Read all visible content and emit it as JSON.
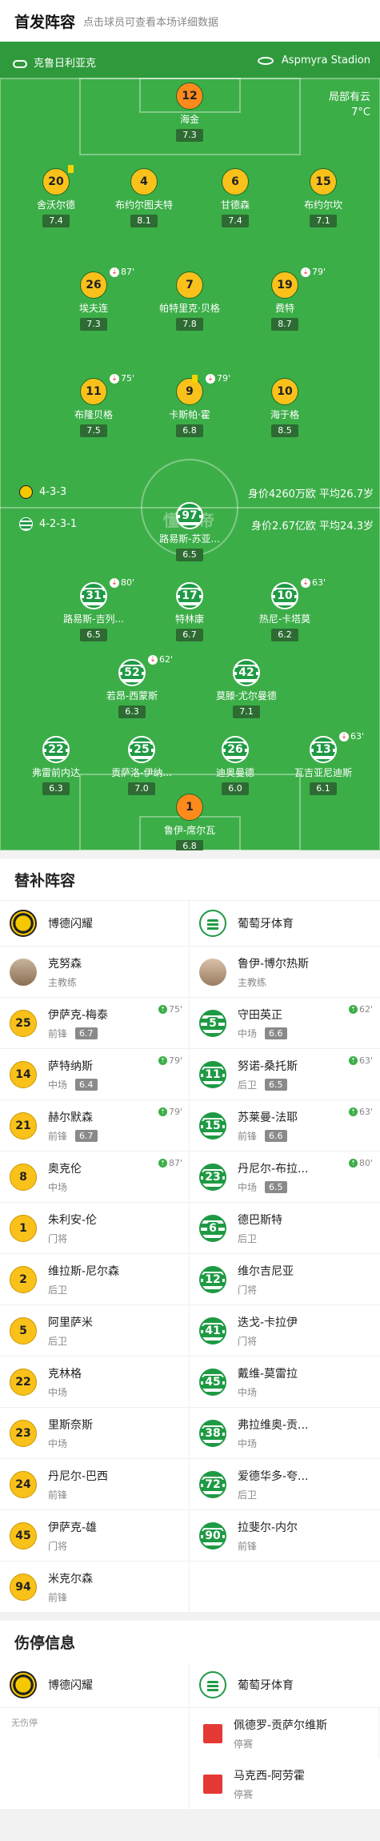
{
  "header": {
    "title": "首发阵容",
    "subtitle": "点击球员可查看本场详细数据"
  },
  "pitch": {
    "home_team": "克鲁日利亚克",
    "venue": "Aspmyra Stadion",
    "weather": "局部有云",
    "temp": "7°C",
    "watermark": "懂球帝",
    "home_formation": "4-3-3",
    "home_stats": "身价4260万欧  平均26.7岁",
    "away_formation": "4-2-3-1",
    "away_stats": "身价2.67亿欧  平均24.3岁",
    "home_players": [
      {
        "num": "12",
        "name": "海金",
        "rating": "7.3"
      },
      {
        "num": "20",
        "name": "舍沃尔德",
        "rating": "7.4"
      },
      {
        "num": "4",
        "name": "布约尔图夫特",
        "rating": "8.1"
      },
      {
        "num": "6",
        "name": "甘德森",
        "rating": "7.4"
      },
      {
        "num": "15",
        "name": "布约尔坎",
        "rating": "7.1"
      },
      {
        "num": "26",
        "name": "埃夫连",
        "rating": "7.3",
        "sub": "87'"
      },
      {
        "num": "7",
        "name": "帕特里克·贝格",
        "rating": "7.8"
      },
      {
        "num": "19",
        "name": "费特",
        "rating": "8.7",
        "sub": "79'"
      },
      {
        "num": "11",
        "name": "布隆贝格",
        "rating": "7.5",
        "sub": "75'"
      },
      {
        "num": "9",
        "name": "卡斯帕·霍",
        "rating": "6.8",
        "sub": "79'"
      },
      {
        "num": "10",
        "name": "海于格",
        "rating": "8.5"
      }
    ],
    "away_players": [
      {
        "num": "97",
        "name": "路易斯-苏亚...",
        "rating": "6.5"
      },
      {
        "num": "31",
        "name": "路易斯-吉列...",
        "rating": "6.5",
        "sub": "80'"
      },
      {
        "num": "17",
        "name": "特林康",
        "rating": "6.7"
      },
      {
        "num": "10",
        "name": "热尼-卡塔莫",
        "rating": "6.2",
        "sub": "63'"
      },
      {
        "num": "52",
        "name": "若昂-西蒙斯",
        "rating": "6.3",
        "sub": "62'"
      },
      {
        "num": "42",
        "name": "莫滕·尤尔曼德",
        "rating": "7.1"
      },
      {
        "num": "22",
        "name": "弗雷前内达",
        "rating": "6.3"
      },
      {
        "num": "25",
        "name": "贡萨洛-伊纳...",
        "rating": "7.0"
      },
      {
        "num": "26",
        "name": "迪奥曼德",
        "rating": "6.0"
      },
      {
        "num": "13",
        "name": "瓦吉亚尼迪斯",
        "rating": "6.1",
        "sub": "63'"
      },
      {
        "num": "1",
        "name": "鲁伊-席尔瓦",
        "rating": "6.8"
      }
    ]
  },
  "subs": {
    "title": "替补阵容",
    "home_team": "博德闪耀",
    "away_team": "葡萄牙体育",
    "home_coach": {
      "name": "克努森",
      "role": "主教练"
    },
    "away_coach": {
      "name": "鲁伊-博尔热斯",
      "role": "主教练"
    },
    "rows": [
      [
        {
          "num": "25",
          "name": "伊萨克-梅泰",
          "pos": "前锋",
          "rating": "6.7",
          "in": "75'"
        },
        {
          "num": "5",
          "name": "守田英正",
          "pos": "中场",
          "rating": "6.6",
          "in": "62'"
        }
      ],
      [
        {
          "num": "14",
          "name": "萨特纳斯",
          "pos": "中场",
          "rating": "6.4",
          "in": "79'"
        },
        {
          "num": "11",
          "name": "努诺-桑托斯",
          "pos": "后卫",
          "rating": "6.5",
          "in": "63'"
        }
      ],
      [
        {
          "num": "21",
          "name": "赫尔默森",
          "pos": "前锋",
          "rating": "6.7",
          "in": "79'"
        },
        {
          "num": "15",
          "name": "苏莱曼-法耶",
          "pos": "前锋",
          "rating": "6.6",
          "in": "63'"
        }
      ],
      [
        {
          "num": "8",
          "name": "奥克伦",
          "pos": "中场",
          "rating": "",
          "in": "87'"
        },
        {
          "num": "23",
          "name": "丹尼尔-布拉...",
          "pos": "中场",
          "rating": "6.5",
          "in": "80'"
        }
      ],
      [
        {
          "num": "1",
          "name": "朱利安-伦",
          "pos": "门将"
        },
        {
          "num": "6",
          "name": "德巴斯特",
          "pos": "后卫"
        }
      ],
      [
        {
          "num": "2",
          "name": "维拉斯-尼尔森",
          "pos": "后卫"
        },
        {
          "num": "12",
          "name": "维尔吉尼亚",
          "pos": "门将"
        }
      ],
      [
        {
          "num": "5",
          "name": "阿里萨米",
          "pos": "后卫"
        },
        {
          "num": "41",
          "name": "迭戈-卡拉伊",
          "pos": "门将"
        }
      ],
      [
        {
          "num": "22",
          "name": "克林格",
          "pos": "中场"
        },
        {
          "num": "45",
          "name": "戴维-莫雷拉",
          "pos": "中场"
        }
      ],
      [
        {
          "num": "23",
          "name": "里斯奈斯",
          "pos": "中场"
        },
        {
          "num": "38",
          "name": "弗拉维奥-贡...",
          "pos": "中场"
        }
      ],
      [
        {
          "num": "24",
          "name": "丹尼尔-巴西",
          "pos": "前锋"
        },
        {
          "num": "72",
          "name": "爱德华多-夸...",
          "pos": "后卫"
        }
      ],
      [
        {
          "num": "45",
          "name": "伊萨克-雄",
          "pos": "门将"
        },
        {
          "num": "90",
          "name": "拉斐尔-内尔",
          "pos": "前锋"
        }
      ],
      [
        {
          "num": "94",
          "name": "米克尔森",
          "pos": "前锋"
        }
      ]
    ]
  },
  "injuries": {
    "title": "伤停信息",
    "home_team": "博德闪耀",
    "away_team": "葡萄牙体育",
    "home_none": "无伤停",
    "away": [
      {
        "name": "佩德罗-贡萨尔维斯",
        "status": "停赛"
      },
      {
        "name": "马克西-阿劳霍",
        "status": "停赛"
      }
    ]
  }
}
